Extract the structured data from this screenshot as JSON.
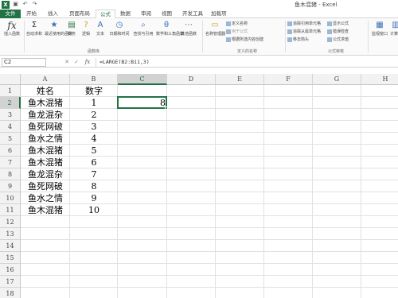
{
  "window": {
    "title": "鱼木混猪 - Excel",
    "logo": "X"
  },
  "quick_access": {
    "save_icon": "save-icon",
    "undo_icon": "undo-icon",
    "redo_icon": "redo-icon"
  },
  "tabs": [
    {
      "label": "文件"
    },
    {
      "label": "开始"
    },
    {
      "label": "插入"
    },
    {
      "label": "页面布局"
    },
    {
      "label": "公式"
    },
    {
      "label": "数据"
    },
    {
      "label": "审阅"
    },
    {
      "label": "视图"
    },
    {
      "label": "开发工具"
    },
    {
      "label": "加载项"
    }
  ],
  "ribbon": {
    "insert_function": "插入函数",
    "autosum": "自动求和",
    "recent": "最近使用的函数",
    "financial": "财务",
    "logical": "逻辑",
    "text": "文本",
    "datetime": "日期和时间",
    "lookup": "查找与引用",
    "math": "数学和三角函数",
    "other": "其他函数",
    "name_manager": "名称管理器",
    "define_name": "定义名称",
    "use_in_formula": "用于公式",
    "create_from_sel": "根据所选内容创建",
    "trace_prec": "追踪引用单元格",
    "trace_dep": "追踪从属单元格",
    "remove_arrows": "移去箭头",
    "show_formulas": "显示公式",
    "error_check": "错误检查",
    "evaluate": "公式求值",
    "watch_window": "监视窗口",
    "calc": "计算",
    "group_library": "函数库",
    "group_names": "定义的名称",
    "group_audit": "公式审核"
  },
  "formula_bar": {
    "name_box": "C2",
    "cancel": "✕",
    "enter": "✓",
    "fx": "fx",
    "formula": "=LARGE(B2:B11,3)"
  },
  "columns": [
    "A",
    "B",
    "C",
    "D",
    "E",
    "F",
    "G",
    "H"
  ],
  "rows": [
    "1",
    "2",
    "3",
    "4",
    "5",
    "6",
    "7",
    "8",
    "9",
    "10",
    "11",
    "12",
    "13",
    "14",
    "15",
    "16",
    "17",
    "18"
  ],
  "header_row": {
    "a": "姓名",
    "b": "数字"
  },
  "data_rows": [
    {
      "name": "鱼木混猪",
      "num": "1"
    },
    {
      "name": "鱼龙混杂",
      "num": "2"
    },
    {
      "name": "鱼死网破",
      "num": "3"
    },
    {
      "name": "鱼水之情",
      "num": "4"
    },
    {
      "name": "鱼木混猪",
      "num": "5"
    },
    {
      "name": "鱼木混猪",
      "num": "6"
    },
    {
      "name": "鱼龙混杂",
      "num": "7"
    },
    {
      "name": "鱼死网破",
      "num": "8"
    },
    {
      "name": "鱼水之情",
      "num": "9"
    },
    {
      "name": "鱼木混猪",
      "num": "10"
    }
  ],
  "result_cell": {
    "ref": "C2",
    "value": "8"
  },
  "colors": {
    "accent": "#217346"
  }
}
